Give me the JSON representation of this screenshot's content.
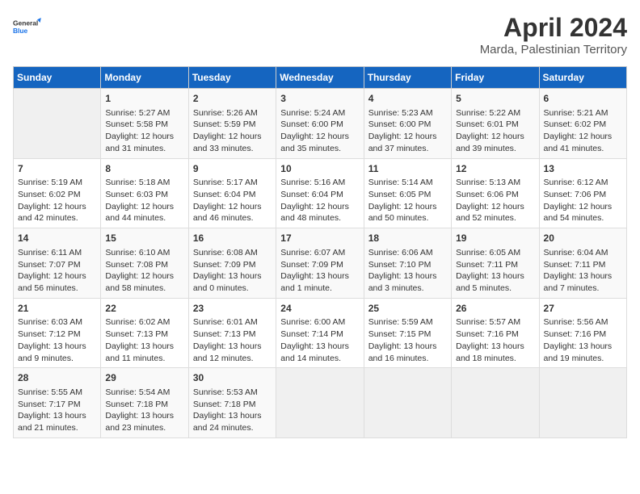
{
  "logo": {
    "line1": "General",
    "line2": "Blue"
  },
  "title": "April 2024",
  "location": "Marda, Palestinian Territory",
  "days_of_week": [
    "Sunday",
    "Monday",
    "Tuesday",
    "Wednesday",
    "Thursday",
    "Friday",
    "Saturday"
  ],
  "weeks": [
    [
      {
        "day": "",
        "info": ""
      },
      {
        "day": "1",
        "info": "Sunrise: 5:27 AM\nSunset: 5:58 PM\nDaylight: 12 hours\nand 31 minutes."
      },
      {
        "day": "2",
        "info": "Sunrise: 5:26 AM\nSunset: 5:59 PM\nDaylight: 12 hours\nand 33 minutes."
      },
      {
        "day": "3",
        "info": "Sunrise: 5:24 AM\nSunset: 6:00 PM\nDaylight: 12 hours\nand 35 minutes."
      },
      {
        "day": "4",
        "info": "Sunrise: 5:23 AM\nSunset: 6:00 PM\nDaylight: 12 hours\nand 37 minutes."
      },
      {
        "day": "5",
        "info": "Sunrise: 5:22 AM\nSunset: 6:01 PM\nDaylight: 12 hours\nand 39 minutes."
      },
      {
        "day": "6",
        "info": "Sunrise: 5:21 AM\nSunset: 6:02 PM\nDaylight: 12 hours\nand 41 minutes."
      }
    ],
    [
      {
        "day": "7",
        "info": "Sunrise: 5:19 AM\nSunset: 6:02 PM\nDaylight: 12 hours\nand 42 minutes."
      },
      {
        "day": "8",
        "info": "Sunrise: 5:18 AM\nSunset: 6:03 PM\nDaylight: 12 hours\nand 44 minutes."
      },
      {
        "day": "9",
        "info": "Sunrise: 5:17 AM\nSunset: 6:04 PM\nDaylight: 12 hours\nand 46 minutes."
      },
      {
        "day": "10",
        "info": "Sunrise: 5:16 AM\nSunset: 6:04 PM\nDaylight: 12 hours\nand 48 minutes."
      },
      {
        "day": "11",
        "info": "Sunrise: 5:14 AM\nSunset: 6:05 PM\nDaylight: 12 hours\nand 50 minutes."
      },
      {
        "day": "12",
        "info": "Sunrise: 5:13 AM\nSunset: 6:06 PM\nDaylight: 12 hours\nand 52 minutes."
      },
      {
        "day": "13",
        "info": "Sunrise: 6:12 AM\nSunset: 7:06 PM\nDaylight: 12 hours\nand 54 minutes."
      }
    ],
    [
      {
        "day": "14",
        "info": "Sunrise: 6:11 AM\nSunset: 7:07 PM\nDaylight: 12 hours\nand 56 minutes."
      },
      {
        "day": "15",
        "info": "Sunrise: 6:10 AM\nSunset: 7:08 PM\nDaylight: 12 hours\nand 58 minutes."
      },
      {
        "day": "16",
        "info": "Sunrise: 6:08 AM\nSunset: 7:09 PM\nDaylight: 13 hours\nand 0 minutes."
      },
      {
        "day": "17",
        "info": "Sunrise: 6:07 AM\nSunset: 7:09 PM\nDaylight: 13 hours\nand 1 minute."
      },
      {
        "day": "18",
        "info": "Sunrise: 6:06 AM\nSunset: 7:10 PM\nDaylight: 13 hours\nand 3 minutes."
      },
      {
        "day": "19",
        "info": "Sunrise: 6:05 AM\nSunset: 7:11 PM\nDaylight: 13 hours\nand 5 minutes."
      },
      {
        "day": "20",
        "info": "Sunrise: 6:04 AM\nSunset: 7:11 PM\nDaylight: 13 hours\nand 7 minutes."
      }
    ],
    [
      {
        "day": "21",
        "info": "Sunrise: 6:03 AM\nSunset: 7:12 PM\nDaylight: 13 hours\nand 9 minutes."
      },
      {
        "day": "22",
        "info": "Sunrise: 6:02 AM\nSunset: 7:13 PM\nDaylight: 13 hours\nand 11 minutes."
      },
      {
        "day": "23",
        "info": "Sunrise: 6:01 AM\nSunset: 7:13 PM\nDaylight: 13 hours\nand 12 minutes."
      },
      {
        "day": "24",
        "info": "Sunrise: 6:00 AM\nSunset: 7:14 PM\nDaylight: 13 hours\nand 14 minutes."
      },
      {
        "day": "25",
        "info": "Sunrise: 5:59 AM\nSunset: 7:15 PM\nDaylight: 13 hours\nand 16 minutes."
      },
      {
        "day": "26",
        "info": "Sunrise: 5:57 AM\nSunset: 7:16 PM\nDaylight: 13 hours\nand 18 minutes."
      },
      {
        "day": "27",
        "info": "Sunrise: 5:56 AM\nSunset: 7:16 PM\nDaylight: 13 hours\nand 19 minutes."
      }
    ],
    [
      {
        "day": "28",
        "info": "Sunrise: 5:55 AM\nSunset: 7:17 PM\nDaylight: 13 hours\nand 21 minutes."
      },
      {
        "day": "29",
        "info": "Sunrise: 5:54 AM\nSunset: 7:18 PM\nDaylight: 13 hours\nand 23 minutes."
      },
      {
        "day": "30",
        "info": "Sunrise: 5:53 AM\nSunset: 7:18 PM\nDaylight: 13 hours\nand 24 minutes."
      },
      {
        "day": "",
        "info": ""
      },
      {
        "day": "",
        "info": ""
      },
      {
        "day": "",
        "info": ""
      },
      {
        "day": "",
        "info": ""
      }
    ]
  ]
}
